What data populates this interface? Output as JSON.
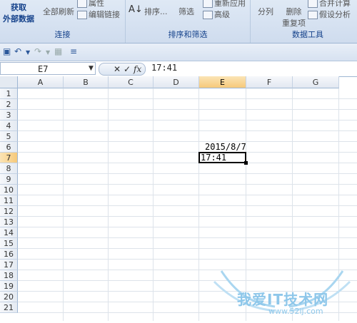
{
  "ribbon": {
    "get_data_line1": "获取",
    "get_data_line2": "外部数据",
    "refresh_all": "全部刷新",
    "properties": "属性",
    "edit_links": "编辑链接",
    "group_connections": "连接",
    "sort": "排序...",
    "filter": "筛选",
    "reapply": "重新应用",
    "advanced": "高级",
    "group_sort_filter": "排序和筛选",
    "text_to_columns": "分列",
    "remove_dup_line1": "删除",
    "remove_dup_line2": "重复项",
    "consolidate": "合并计算",
    "what_if": "假设分析",
    "group_data_tools": "数据工具"
  },
  "formula_bar": {
    "name_box": "E7",
    "fx": "fx",
    "cancel": "✕",
    "enter": "✓",
    "content": "17:41"
  },
  "columns": [
    "A",
    "B",
    "C",
    "D",
    "E",
    "F",
    "G"
  ],
  "active_column": "E",
  "rows": [
    "1",
    "2",
    "3",
    "4",
    "5",
    "6",
    "7",
    "8",
    "9",
    "10",
    "11",
    "12",
    "13",
    "14",
    "15",
    "16",
    "17",
    "18",
    "19",
    "20",
    "21"
  ],
  "active_row": "7",
  "cells": {
    "E6": "2015/8/7",
    "E7": "17:41"
  },
  "watermark": {
    "text": "我爱IT技术网",
    "url": "www.52ij.com"
  }
}
